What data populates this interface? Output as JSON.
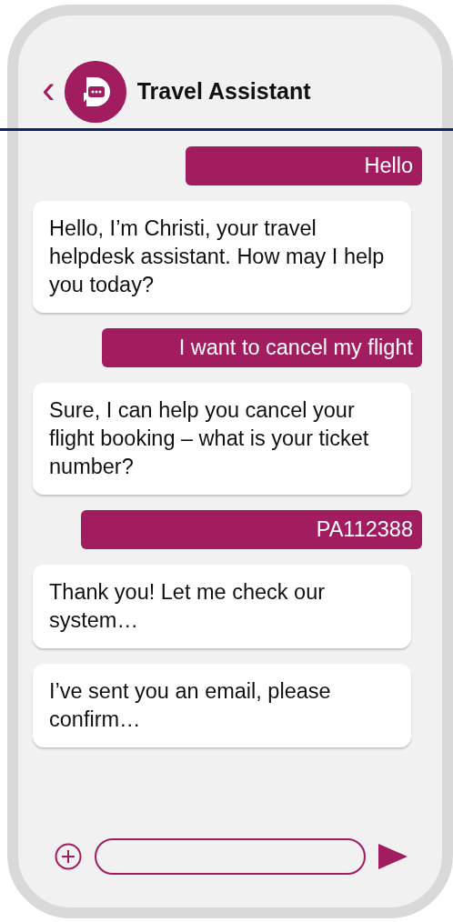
{
  "header": {
    "back": "‹",
    "title": "Travel Assistant"
  },
  "messages": [
    {
      "kind": "sent",
      "text": "Hello"
    },
    {
      "kind": "received",
      "text": "Hello, I’m Christi, your travel helpdesk assistant. How may I help you today?"
    },
    {
      "kind": "sent",
      "text": "I want to cancel my flight"
    },
    {
      "kind": "received",
      "text": "Sure, I can help you cancel your flight booking – what is your ticket number?"
    },
    {
      "kind": "sent",
      "text": "PA112388"
    },
    {
      "kind": "received",
      "text": "Thank you! Let me check our system…"
    },
    {
      "kind": "received",
      "text": "I’ve sent you an email, please confirm…"
    }
  ]
}
